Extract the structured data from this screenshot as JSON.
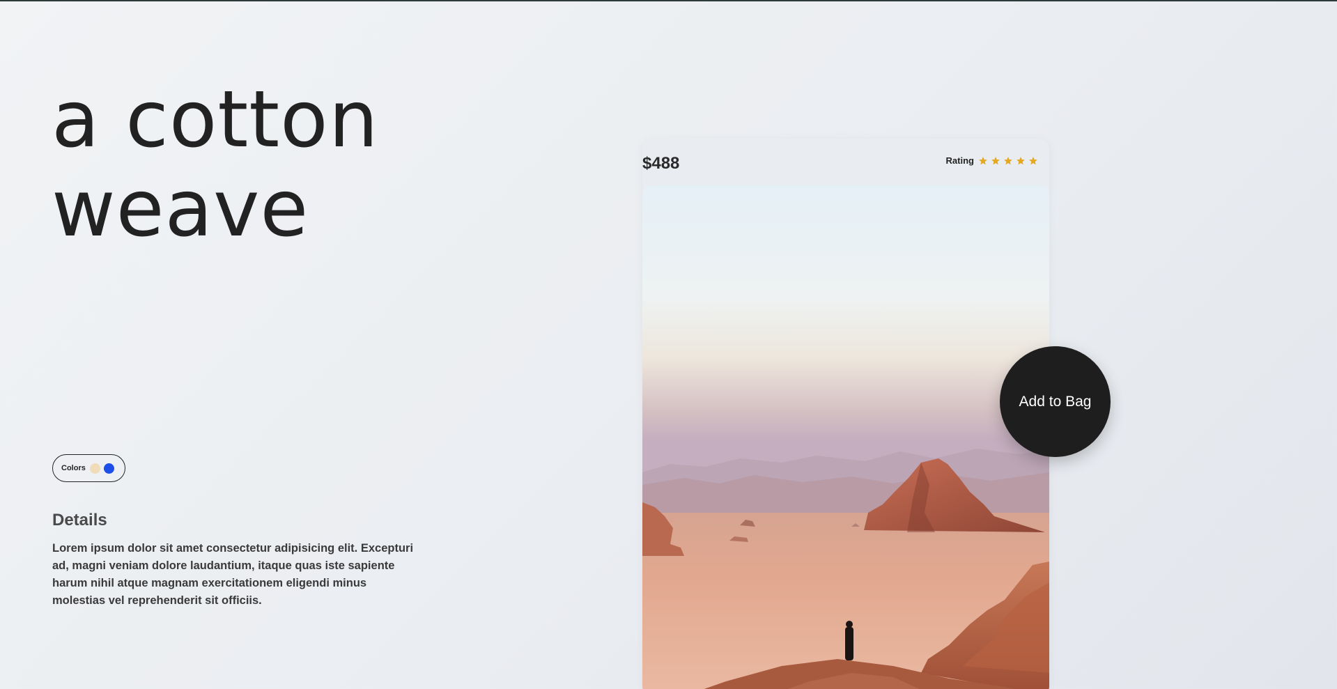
{
  "hero": {
    "headline_line1": "a cotton",
    "headline_line2": "weave"
  },
  "colors": {
    "label": "Colors",
    "options": [
      {
        "name": "cream",
        "hex": "#f0dcb8"
      },
      {
        "name": "blue",
        "hex": "#1d4fe8"
      }
    ]
  },
  "details": {
    "title": "Details",
    "body": "Lorem ipsum dolor sit amet consectetur adipisicing elit. Excepturi ad, magni veniam dolore laudantium, itaque quas iste sapiente harum nihil atque magnam exercitationem eligendi minus molestias vel reprehenderit sit officiis."
  },
  "product": {
    "price": "$488",
    "rating_label": "Rating",
    "rating": 5,
    "rating_max": 5,
    "star_color": "#e5a823",
    "image_subject": "desert landscape with rock formations and a lone figure"
  },
  "cta": {
    "add_to_bag_label": "Add to Bag"
  }
}
